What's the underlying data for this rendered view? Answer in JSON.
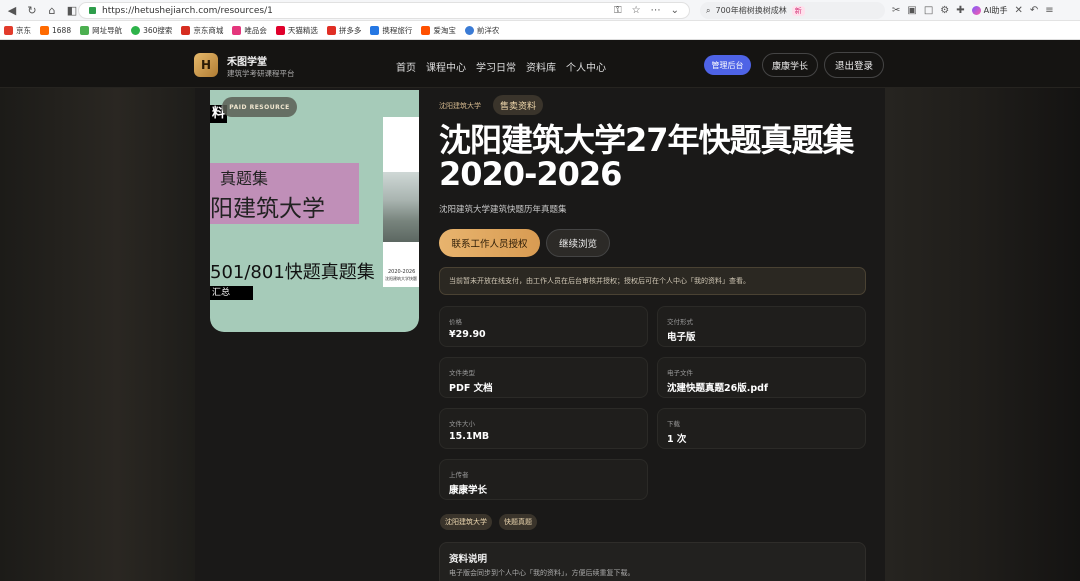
{
  "browser": {
    "url": "https://hetushejiarch.com/resources/1",
    "search_text": "700年榕树换树成林",
    "search_badge": "新",
    "ai_label": "AI助手",
    "bookmarks": [
      "京东",
      "1688",
      "网址导航",
      "360搜索",
      "京东商城",
      "唯品会",
      "天猫精选",
      "拼多多",
      "携程旅行",
      "爱淘宝",
      "前洋农"
    ]
  },
  "header": {
    "logo_letter": "H",
    "brand_name": "禾图学堂",
    "brand_sub": "建筑学考研课程平台",
    "nav": [
      "首页",
      "课程中心",
      "学习日常",
      "资料库",
      "个人中心"
    ],
    "admin_label": "管理后台",
    "user_label": "康康学长",
    "logout_label": "退出登录"
  },
  "cover": {
    "badge": "PAID RESOURCE",
    "fragment_top": "料",
    "pink_line1": "真题集",
    "pink_line2": "阳建筑大学",
    "big_line": "501/801快题真题集",
    "summary": "汇总",
    "photo_years": "2020-2026",
    "photo_caption": "沈阳建筑大学快题"
  },
  "resource": {
    "breadcrumb": "沈阳建筑大学",
    "sale_tag": "售卖资料",
    "title": "沈阳建筑大学27年快题真题集2020-2026",
    "subtitle": "沈阳建筑大学建筑快题历年真题集",
    "contact_btn": "联系工作人员授权",
    "browse_btn": "继续浏览",
    "notice": "当前暂未开放在线支付，由工作人员在后台审核并授权；授权后可在个人中心「我的资料」查看。",
    "fields": [
      {
        "label": "价格",
        "value": "¥29.90"
      },
      {
        "label": "交付形式",
        "value": "电子版"
      },
      {
        "label": "文件类型",
        "value": "PDF 文档"
      },
      {
        "label": "电子文件",
        "value": "沈建快题真题26版.pdf"
      },
      {
        "label": "文件大小",
        "value": "15.1MB"
      },
      {
        "label": "下载",
        "value": "1 次"
      },
      {
        "label": "上传者",
        "value": "康康学长"
      }
    ],
    "tags": [
      "沈阳建筑大学",
      "快题真题"
    ],
    "desc_title": "资料说明",
    "desc_text": "电子版会同步到个人中心「我的资料」，方便后续重复下载。"
  },
  "colors": {
    "accent_gold": "#e8b46e",
    "admin_blue": "#4e63e6",
    "cover_green": "#a6cbb9",
    "cover_pink": "#c08fb8"
  }
}
